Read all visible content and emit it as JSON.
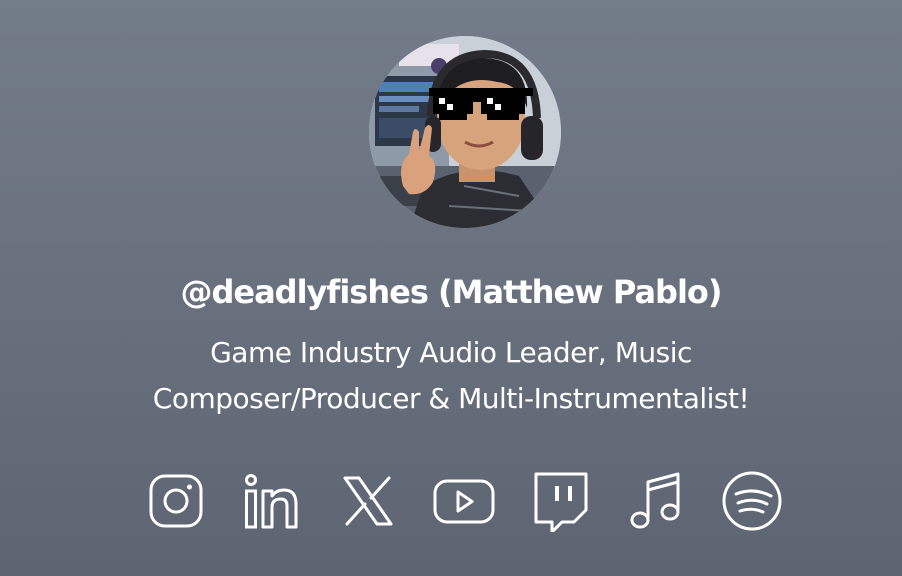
{
  "profile": {
    "name": "@deadlyfishes (Matthew Pablo)",
    "bio_line1": "Game Industry Audio Leader, Music",
    "bio_line2": "Composer/Producer & Multi-Instrumentalist!",
    "avatar_icon": "avatar-photo"
  },
  "socials": [
    {
      "icon": "instagram-icon",
      "label": "Instagram"
    },
    {
      "icon": "linkedin-icon",
      "label": "LinkedIn"
    },
    {
      "icon": "x-icon",
      "label": "X"
    },
    {
      "icon": "youtube-icon",
      "label": "YouTube"
    },
    {
      "icon": "twitch-icon",
      "label": "Twitch"
    },
    {
      "icon": "music-note-icon",
      "label": "Music"
    },
    {
      "icon": "spotify-icon",
      "label": "Spotify"
    }
  ],
  "colors": {
    "background_top": "#737c89",
    "background_bottom": "#5d6472",
    "text": "#ffffff"
  }
}
